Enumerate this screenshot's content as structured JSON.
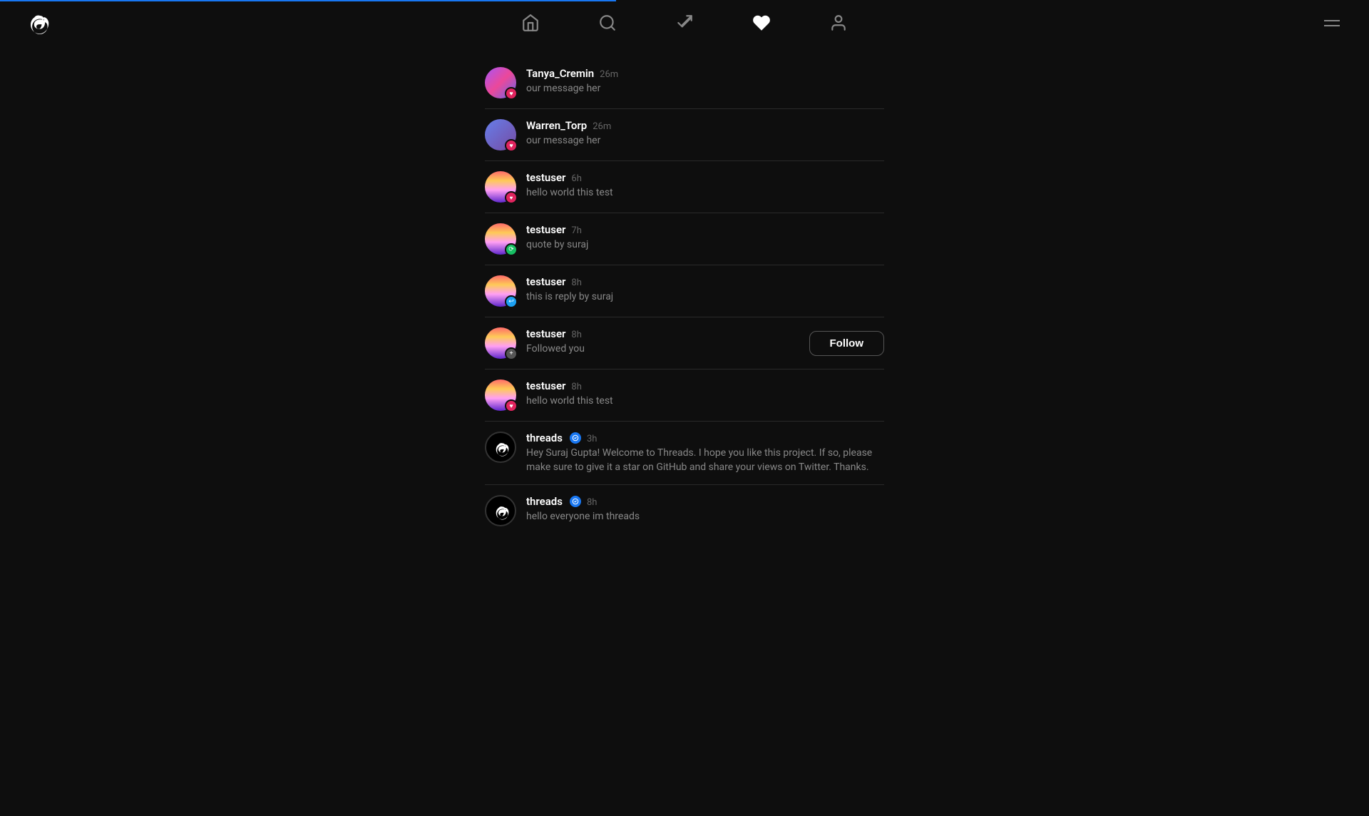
{
  "app": {
    "logo_label": "Threads logo",
    "loading_bar_visible": true
  },
  "nav": {
    "items": [
      {
        "id": "home",
        "label": "Home",
        "active": false
      },
      {
        "id": "search",
        "label": "Search",
        "active": false
      },
      {
        "id": "compose",
        "label": "Compose",
        "active": false
      },
      {
        "id": "activity",
        "label": "Activity",
        "active": true
      },
      {
        "id": "profile",
        "label": "Profile",
        "active": false
      }
    ],
    "menu_label": "Menu"
  },
  "notifications": [
    {
      "id": 1,
      "username": "Tanya_Cremin",
      "time": "26m",
      "text": "our message her",
      "badge_type": "heart",
      "avatar_type": "tanya"
    },
    {
      "id": 2,
      "username": "Warren_Torp",
      "time": "26m",
      "text": "our message her",
      "badge_type": "heart",
      "avatar_type": "purple"
    },
    {
      "id": 3,
      "username": "testuser",
      "time": "6h",
      "text": "hello world this test",
      "badge_type": "mention",
      "avatar_type": "sunset"
    },
    {
      "id": 4,
      "username": "testuser",
      "time": "7h",
      "text": "quote by suraj",
      "badge_type": "repost",
      "avatar_type": "sunset"
    },
    {
      "id": 5,
      "username": "testuser",
      "time": "8h",
      "text": "this is reply by suraj",
      "badge_type": "reply",
      "avatar_type": "sunset"
    },
    {
      "id": 6,
      "username": "testuser",
      "time": "8h",
      "text": "Followed you",
      "badge_type": "follow",
      "avatar_type": "sunset",
      "show_follow_btn": true,
      "follow_label": "Follow"
    },
    {
      "id": 7,
      "username": "testuser",
      "time": "8h",
      "text": "hello world this test",
      "badge_type": "heart",
      "avatar_type": "sunset"
    },
    {
      "id": 8,
      "username": "threads",
      "time": "3h",
      "text": "Hey Suraj Gupta! Welcome to Threads. I hope you like this project. If so, please make sure to give it a star on GitHub and share your views on Twitter. Thanks.",
      "badge_type": "none",
      "avatar_type": "threads",
      "verified": true
    },
    {
      "id": 9,
      "username": "threads",
      "time": "8h",
      "text": "hello everyone im threads",
      "badge_type": "none",
      "avatar_type": "threads",
      "verified": true
    }
  ]
}
